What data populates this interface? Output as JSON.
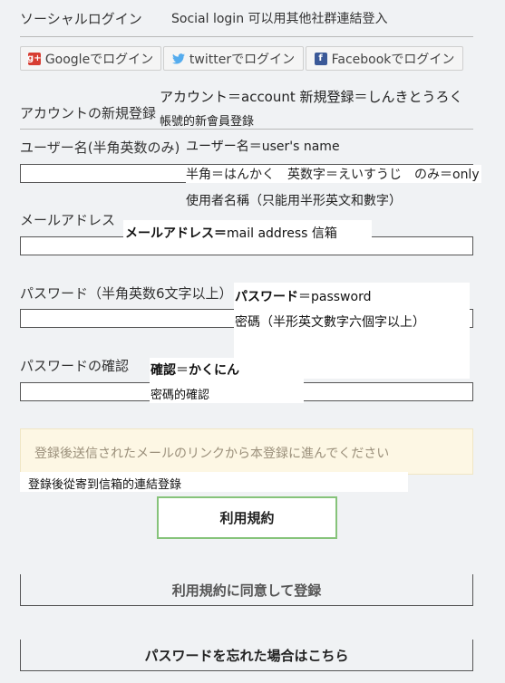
{
  "header": {
    "title": "ソーシャルログイン",
    "translation": "Social login 可以用其他社群連結登入"
  },
  "social": {
    "google": {
      "icon": "google-plus-icon",
      "glyph": "g+",
      "label": "Googleでログイン",
      "color": "#d73d32"
    },
    "twitter": {
      "icon": "twitter-bird-icon",
      "glyph": "🐦",
      "label": "twitterでログイン",
      "color": "#55acee"
    },
    "facebook": {
      "icon": "facebook-icon",
      "glyph": "f",
      "label": "Facebookでログイン",
      "color": "#3b5998"
    }
  },
  "register": {
    "title": "アカウントの新規登録",
    "note1": "アカウント＝account 新規登録＝しんきとうろく",
    "note2": "帳號的新會員登錄"
  },
  "username": {
    "label": "ユーザー名(半角英数のみ)",
    "note1": "ユーザー名＝user's name",
    "note2": "半角＝はんかく　英数字＝えいすうじ　のみ＝only",
    "note3": "使用者名稱（只能用半形英文和數字）",
    "value": ""
  },
  "email": {
    "label": "メールアドレス",
    "note1_bold": "メールアドレス＝",
    "note1_rest": "mail address 信箱",
    "value": ""
  },
  "password": {
    "label": "パスワード（半角英数6文字以上）",
    "note1_bold": "パスワード",
    "note1_rest": "＝password",
    "note2": "密碼（半形英文數字六個字以上）",
    "value": ""
  },
  "confirm": {
    "label": "パスワードの確認",
    "note1_bold": "確認",
    "note1_mid": "＝",
    "note1_bold2": "かくにん",
    "note2": "密碼的確認",
    "value": ""
  },
  "notice": {
    "text": "登録後送信されたメールのリンクから本登録に進んでください",
    "translation": "登錄後從寄到信箱的連結登錄"
  },
  "buttons": {
    "terms": "利用規約",
    "agree_register": "利用規約に同意して登録",
    "forgot_password": "パスワードを忘れた場合はこちら"
  }
}
